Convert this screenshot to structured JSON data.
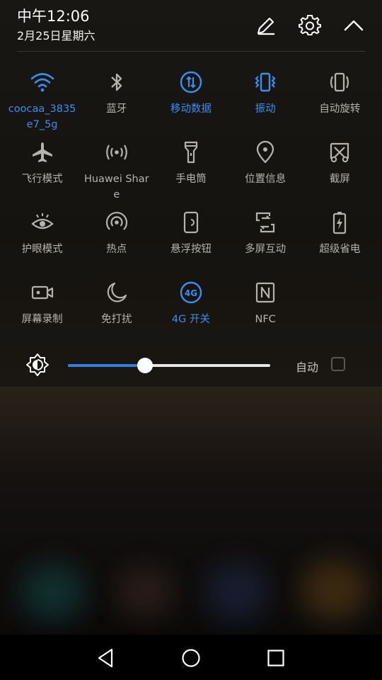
{
  "status": {
    "time": "中午12:06",
    "date": "2月25日星期六"
  },
  "header_icons": [
    "edit-icon",
    "settings-icon",
    "collapse-icon"
  ],
  "colors": {
    "accent": "#3a8ef0",
    "inactive": "#b6b3ae",
    "panel_bg": "#191714"
  },
  "tiles": [
    {
      "label": "coocaa_3835e7_5g",
      "icon": "wifi-icon",
      "active": true
    },
    {
      "label": "蓝牙",
      "icon": "bluetooth-icon",
      "active": false
    },
    {
      "label": "移动数据",
      "icon": "mobile-data-icon",
      "active": true
    },
    {
      "label": "振动",
      "icon": "vibrate-icon",
      "active": true
    },
    {
      "label": "自动旋转",
      "icon": "auto-rotate-icon",
      "active": false
    },
    {
      "label": "飞行模式",
      "icon": "airplane-icon",
      "active": false
    },
    {
      "label": "Huawei Share",
      "icon": "huawei-share-icon",
      "active": false
    },
    {
      "label": "手电筒",
      "icon": "flashlight-icon",
      "active": false
    },
    {
      "label": "位置信息",
      "icon": "location-icon",
      "active": false
    },
    {
      "label": "截屏",
      "icon": "screenshot-icon",
      "active": false
    },
    {
      "label": "护眼模式",
      "icon": "eye-comfort-icon",
      "active": false
    },
    {
      "label": "热点",
      "icon": "hotspot-icon",
      "active": false
    },
    {
      "label": "悬浮按钮",
      "icon": "floating-dock-icon",
      "active": false
    },
    {
      "label": "多屏互动",
      "icon": "multi-screen-icon",
      "active": false
    },
    {
      "label": "超级省电",
      "icon": "ultra-power-saving-icon",
      "active": false
    },
    {
      "label": "屏幕录制",
      "icon": "screen-record-icon",
      "active": false
    },
    {
      "label": "免打扰",
      "icon": "do-not-disturb-icon",
      "active": false
    },
    {
      "label": "4G 开关",
      "icon": "4g-icon",
      "active": true
    },
    {
      "label": "NFC",
      "icon": "nfc-icon",
      "active": false
    }
  ],
  "brightness": {
    "level": 0.38,
    "auto_label": "自动",
    "auto_checked": false
  },
  "navbar": [
    "back-icon",
    "home-icon",
    "recents-icon"
  ]
}
